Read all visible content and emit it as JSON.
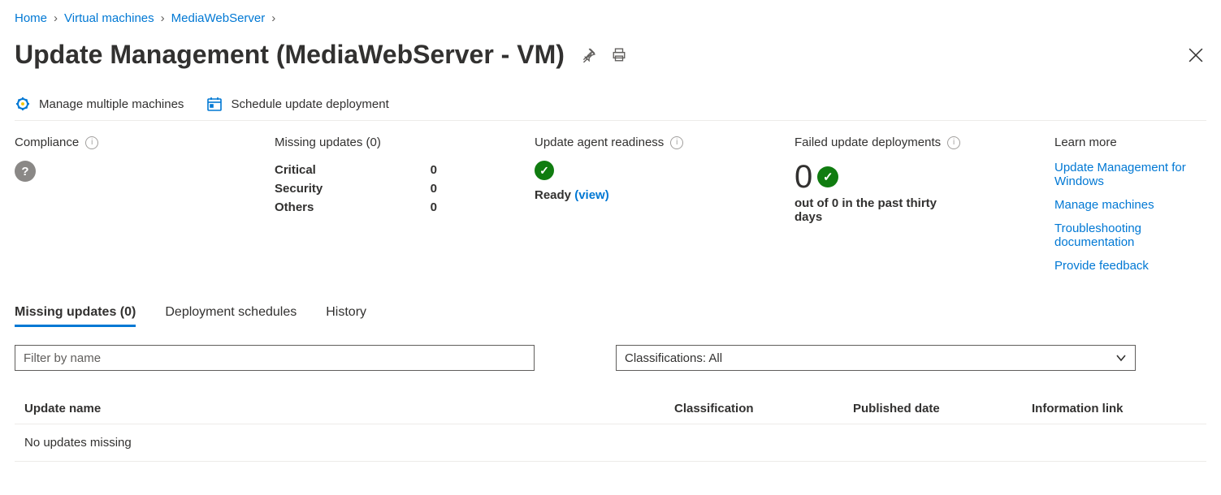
{
  "breadcrumb": {
    "items": [
      "Home",
      "Virtual machines",
      "MediaWebServer"
    ]
  },
  "header": {
    "title": "Update Management (MediaWebServer - VM)"
  },
  "toolbar": {
    "manage_multiple": "Manage multiple machines",
    "schedule_deploy": "Schedule update deployment"
  },
  "summary": {
    "compliance_label": "Compliance",
    "missing_label": "Missing updates (0)",
    "missing_rows": {
      "critical_label": "Critical",
      "critical_value": "0",
      "security_label": "Security",
      "security_value": "0",
      "others_label": "Others",
      "others_value": "0"
    },
    "readiness_label": "Update agent readiness",
    "readiness_status": "Ready",
    "readiness_view": "(view)",
    "failed_label": "Failed update deployments",
    "failed_count": "0",
    "failed_subtext": "out of 0 in the past thirty days",
    "learn_more_label": "Learn more",
    "learn_links": {
      "l1": "Update Management for Windows",
      "l2": "Manage machines",
      "l3": "Troubleshooting documentation",
      "l4": "Provide feedback"
    }
  },
  "tabs": {
    "t1": "Missing updates (0)",
    "t2": "Deployment schedules",
    "t3": "History"
  },
  "filters": {
    "name_placeholder": "Filter by name",
    "classification_display": "Classifications: All"
  },
  "table": {
    "col_name": "Update name",
    "col_class": "Classification",
    "col_pub": "Published date",
    "col_info": "Information link",
    "empty_message": "No updates missing"
  }
}
